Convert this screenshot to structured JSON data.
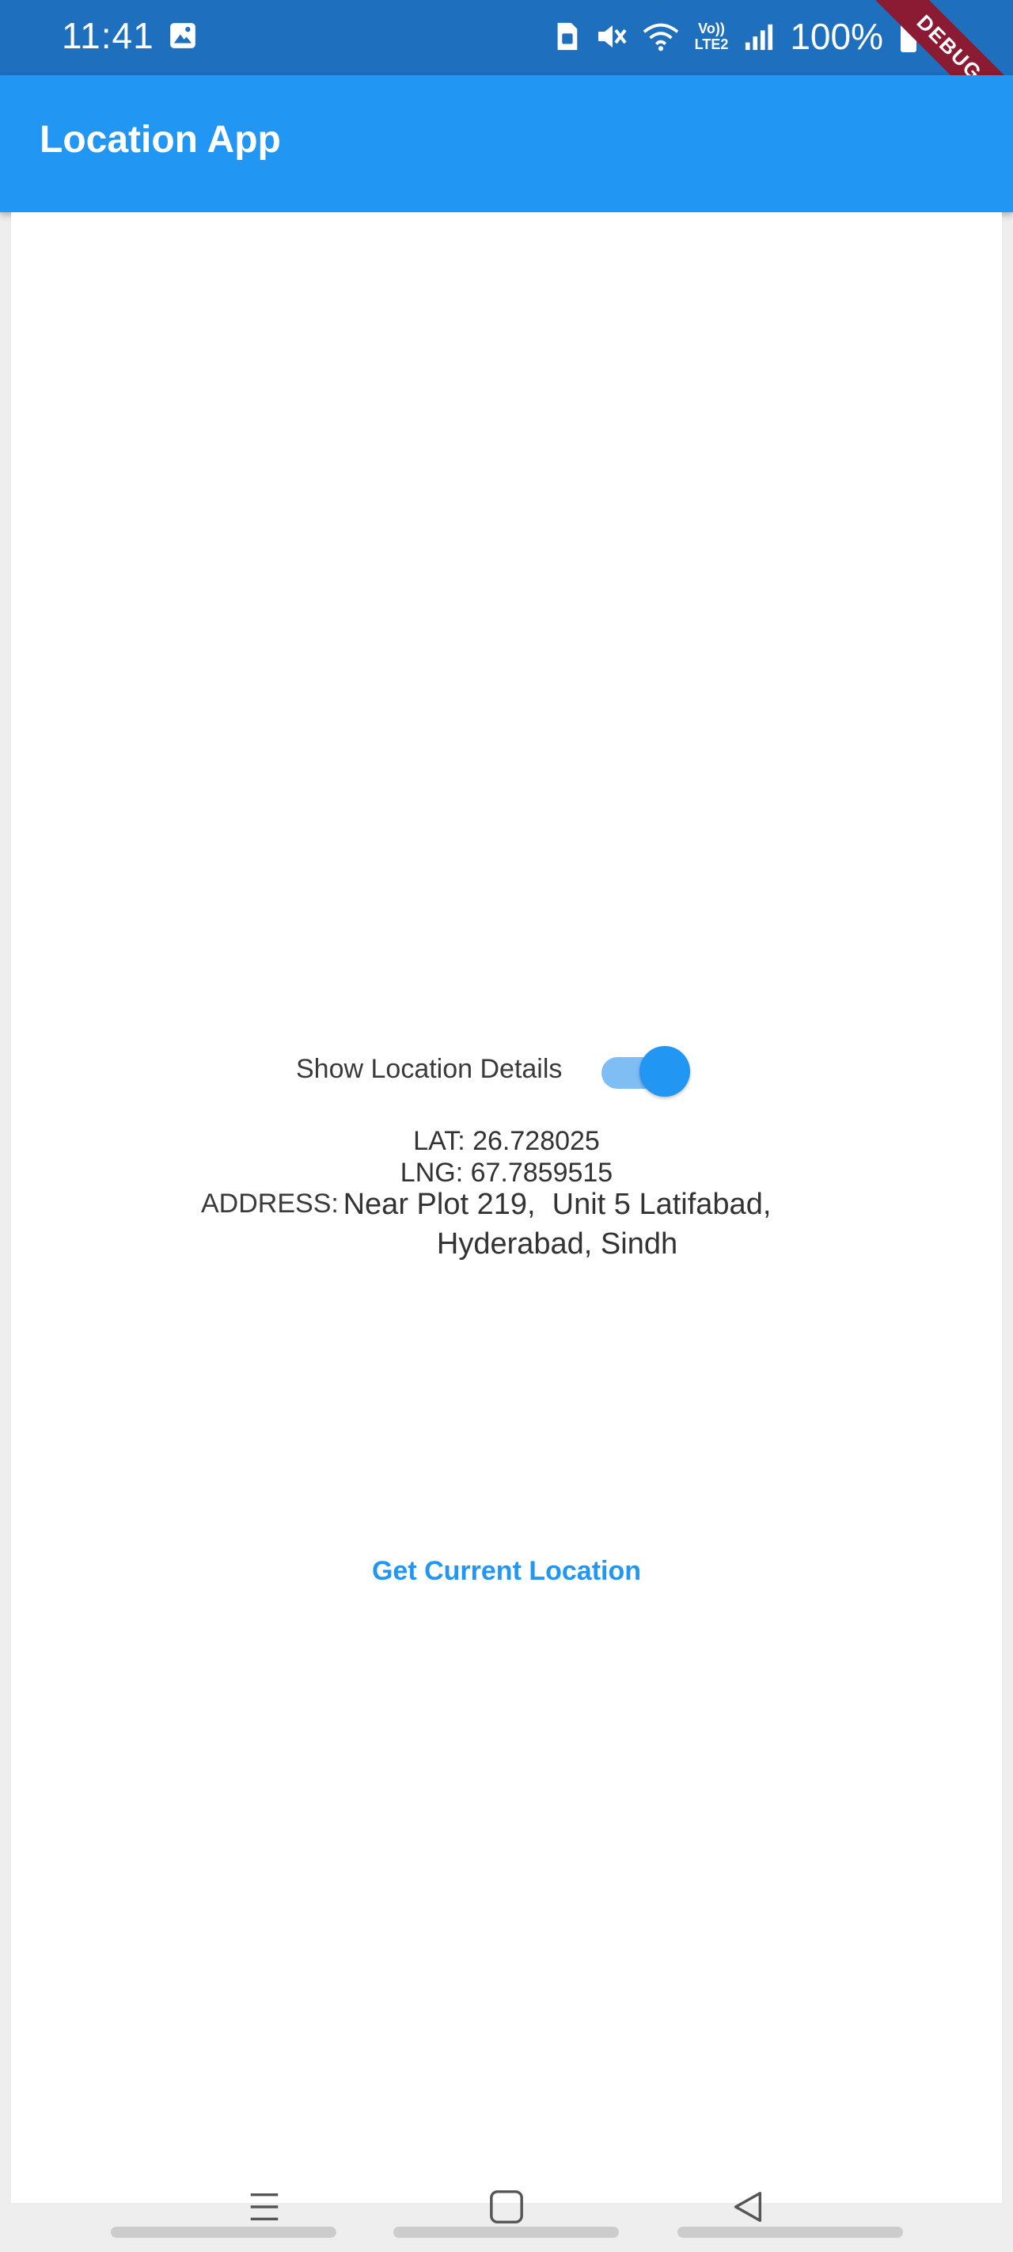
{
  "status_bar": {
    "time": "11:41",
    "battery": "100%",
    "icons": [
      "image-icon",
      "sim-icon",
      "mute-icon",
      "wifi-icon",
      "volte-lte2-icon",
      "signal-icon",
      "battery-icon"
    ],
    "volte_text": "Vo))",
    "lte_text": "LTE2"
  },
  "debug_banner": "DEBUG",
  "app_bar": {
    "title": "Location App"
  },
  "toggle": {
    "label": "Show Location Details",
    "on": true,
    "accent": "#2196f3"
  },
  "location": {
    "lat": "LAT: 26.728025",
    "lng": "LNG: 67.7859515",
    "address_label": "ADDRESS:",
    "address_line1": "Near Plot 219,  Unit 5 Latifabad,",
    "address_line2": "Hyderabad, Sindh"
  },
  "actions": {
    "get_location": "Get Current Location"
  },
  "nav": {
    "icons": [
      "recent-apps-icon",
      "home-icon",
      "back-icon"
    ]
  },
  "colors": {
    "primary": "#2196f3",
    "status_bar": "#1f6fbf",
    "debug": "#8b1a33"
  }
}
